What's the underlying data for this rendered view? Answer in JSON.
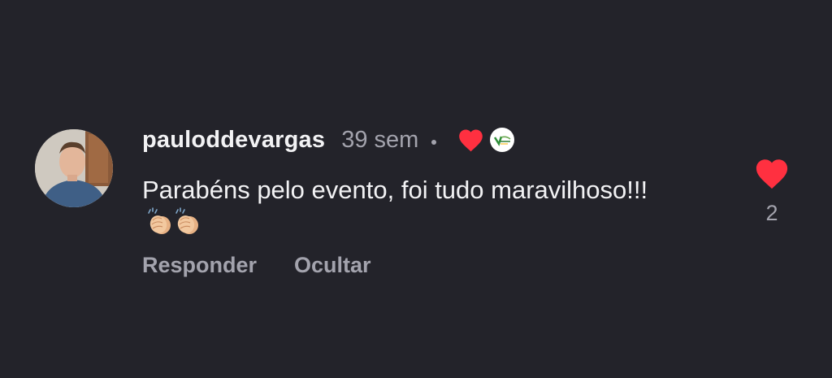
{
  "comment": {
    "username": "pauloddevargas",
    "time": "39 sem",
    "text": "Parabéns pelo evento, foi tudo maravilhoso!!!",
    "emojis": [
      "clapping-hands-icon",
      "clapping-hands-icon"
    ],
    "actions": {
      "reply": "Responder",
      "hide": "Ocultar"
    },
    "likes": "2",
    "creator_liked_icon": "heart-icon",
    "creator_badge_icon": "creator-avatar-icon"
  },
  "colors": {
    "background": "#23232a",
    "text_primary": "#f2f2f4",
    "text_secondary": "#a3a3ad",
    "heart": "#ff3040"
  }
}
